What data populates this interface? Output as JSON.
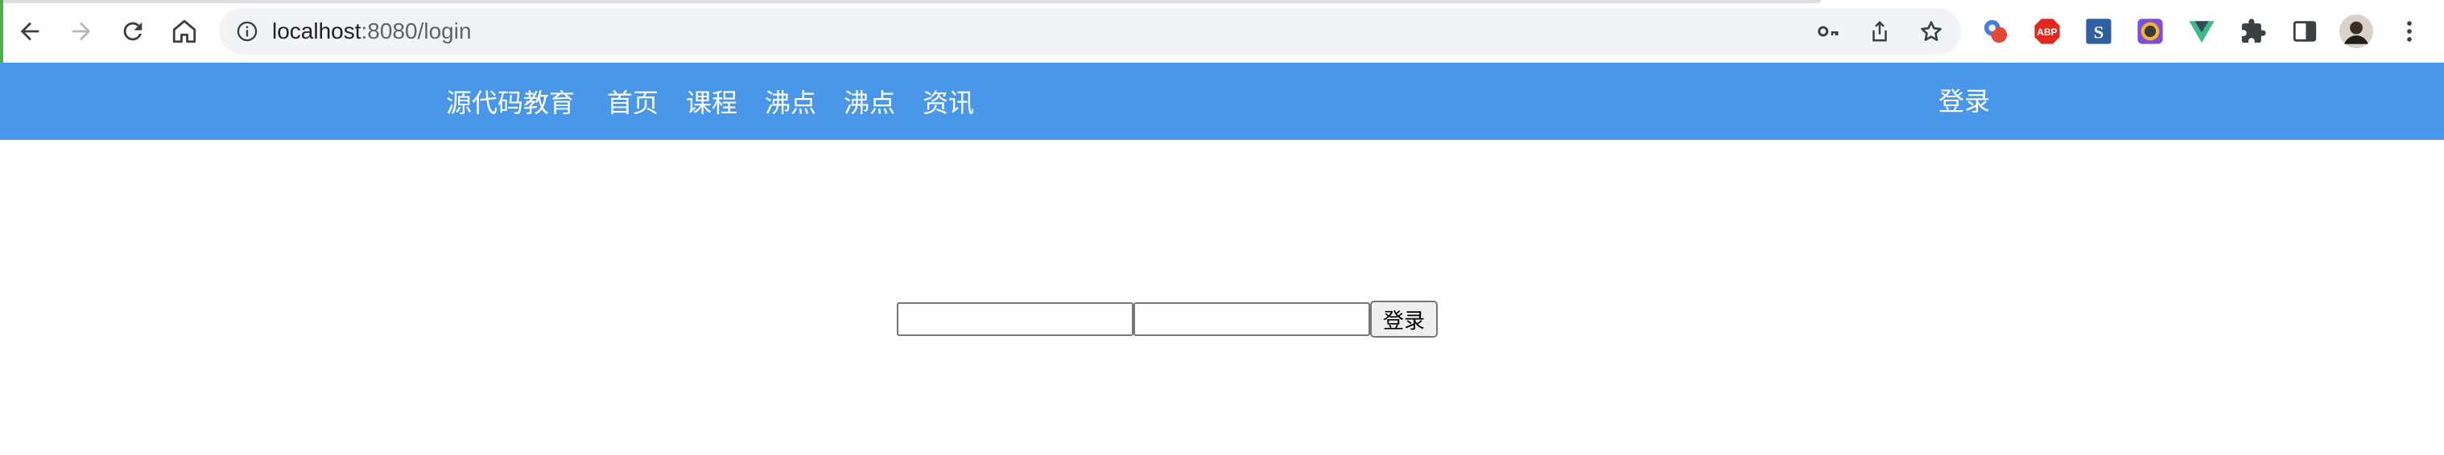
{
  "browser": {
    "url_host": "localhost",
    "url_path": ":8080/login",
    "icons": {
      "back": "arrow-left-icon",
      "forward": "arrow-right-icon",
      "reload": "reload-icon",
      "home": "home-icon",
      "site_info": "info-icon",
      "password": "key-icon",
      "share": "share-icon",
      "bookmark": "star-icon",
      "extensions": "puzzle-icon",
      "side_panel": "side-panel-icon",
      "menu": "kebab-menu-icon"
    },
    "extension_badges": {
      "adblock": "ABP",
      "s_ext": "S"
    },
    "colors": {
      "omnibox_bg": "#f1f3f4",
      "adblock_red": "#e02a20",
      "vue_green": "#41b883"
    }
  },
  "header": {
    "logo": "源代码教育",
    "nav": [
      "首页",
      "课程",
      "沸点",
      "沸点",
      "资讯"
    ],
    "login": "登录",
    "bg_color": "#4a96e8"
  },
  "login_form": {
    "username_value": "",
    "password_value": "",
    "submit_label": "登录"
  }
}
